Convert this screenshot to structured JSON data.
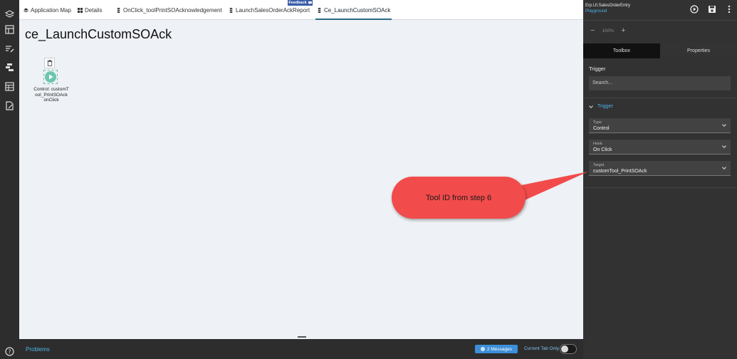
{
  "tabs": [
    {
      "label": "Application Map",
      "icon": "layers-icon"
    },
    {
      "label": "Details",
      "icon": "grid-icon"
    },
    {
      "label": "OnClick_toolPrintSOAcknowledgement",
      "icon": "event-icon"
    },
    {
      "label": "LaunchSalesOrderAckReport",
      "icon": "event-icon"
    },
    {
      "label": "Ce_LaunchCustomSOAck",
      "icon": "event-icon"
    }
  ],
  "feedback_label": "Feedback",
  "page_title": "ce_LaunchCustomSOAck",
  "node": {
    "label": "Control: customTool_PrintSOAck onClick"
  },
  "callout": {
    "text": "Tool ID from step 6",
    "color": "#f24b4b"
  },
  "bottom": {
    "problems": "Problems",
    "messages": "2 Messages",
    "current_tab_only": "Current Tab Only"
  },
  "right_panel": {
    "title": "Erp.UI.SalesOrderEntry",
    "subtitle": "Playground",
    "zoom": "100%",
    "tabs": [
      "Toolbox",
      "Properties"
    ],
    "trigger_heading": "Trigger",
    "search_placeholder": "Search...",
    "section": "Trigger",
    "fields": [
      {
        "label": "Type",
        "value": "Control"
      },
      {
        "label": "Hook",
        "value": "On Click"
      },
      {
        "label": "Target",
        "value": "customTool_PrintSOAck"
      }
    ]
  },
  "colors": {
    "accent": "#4fb3e6",
    "active_tab": "#2a6a84",
    "node": "#6cc6ad"
  }
}
